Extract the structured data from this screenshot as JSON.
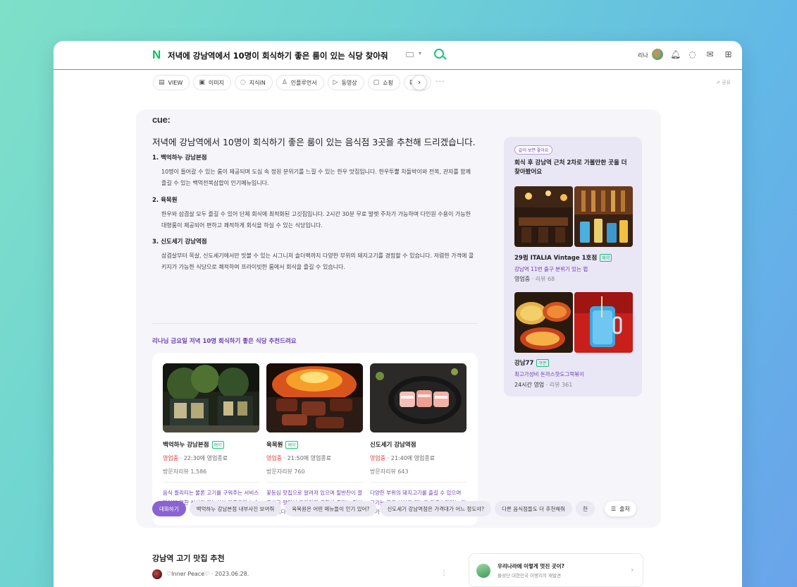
{
  "header": {
    "logo": "N",
    "query": "저녁에 강남역에서 10명이 회식하기 좋은 룸이 있는 식당 찾아줘",
    "user_name": "리나",
    "accent": "#19c37d"
  },
  "tabs": [
    {
      "icon": "▤",
      "label": "VIEW"
    },
    {
      "icon": "▣",
      "label": "이미지"
    },
    {
      "icon": "◌",
      "label": "지식iN"
    },
    {
      "icon": "♙",
      "label": "인플루언서"
    },
    {
      "icon": "▷",
      "label": "동영상"
    },
    {
      "icon": "▢",
      "label": "쇼핑"
    },
    {
      "icon": "▤",
      "label": "뉴"
    }
  ],
  "toolbar": {
    "more": "···",
    "share": "⇗ 공유",
    "next": "›"
  },
  "cue": {
    "logo": "cue:",
    "answer_title": "저녁에 강남역에서 10명이 회식하기 좋은 룸이 있는 음식점 3곳을 추천해 드리겠습니다.",
    "items": [
      {
        "title": "1.  백억하누 강남본점",
        "desc": "10명이 들어갈 수 있는 룸이 제공되며 도심 속 정원 분위기를 느낄 수 있는 한우 맛집입니다. 한우투뿔 차돌박이와 전복, 관자를 함께 즐길 수 있는 백억전복삼합이 인기메뉴입니다."
      },
      {
        "title": "2.  육목원",
        "desc": "한우와 삼겹살 모두 즐길 수 있어 단체 회식에 최적화된 고깃집입니다. 2시간 30분 무료 발렛 주차가 가능하며 다인원 수용이 가능한 대형룸이 제공되어 편하고 쾌적하게 회식을 하실 수 있는 식당입니다."
      },
      {
        "title": "3.  신도세기 강남역점",
        "desc": "삼겹살부터 목살, 신도세기에서만 맛볼 수 있는 시그니처 솔더랙까지 다양한 부위의 돼지고기를 경험할 수 있습니다. 저렴한 가격에 콜키지가 가능한 식당으로 쾌적하며 프라이빗한 룸에서 회식을 즐길 수 있습니다."
      }
    ],
    "reco_title": "리나님 금요일 저녁 10명 회식하기 좋은 식당 추천드려요",
    "cards": [
      {
        "name": "백억하누 강남본점",
        "badge": "예약",
        "status": "영업중",
        "close": " · 22:30에 영업종료",
        "review": "방문자리뷰 1,586",
        "desc": "음식 퀄리티는 물론 고기를 구워주는 서비스 덕분에 편한 식사가 가능하여 만족도가 높습니다."
      },
      {
        "name": "육목원",
        "badge": "예약",
        "status": "영업중",
        "close": " · 21:50에 영업종료",
        "review": "방문자리뷰 760",
        "desc": "꽃등심 맛집으로 알려져 있으며 밑반찬이 깔끔하고 맛있어 고기와의 궁합이 좋다는 평이 많습니다."
      },
      {
        "name": "신도세기 강남역점",
        "badge": "",
        "status": "영업중",
        "close": " · 21:40에 영업종료",
        "review": "방문자리뷰 643",
        "desc": "다양한 부위의 돼지고기를 즐길 수 있으며 고기는 물론 사이드 메뉴도 만족스럽다는 리뷰가 많습니다."
      }
    ],
    "side": {
      "tag": "같이 보면 좋아요",
      "title": "회식 후 강남역 근처 2차로 가볼만한 곳을 더 찾아봤어요",
      "places": [
        {
          "name": "29펍 ITALIA Vintage 1호점",
          "badge": "예약",
          "desc": "강남역 11번 출구 분위기 있는 펍",
          "status": "영업중",
          "review": " · 리뷰 68"
        },
        {
          "name": "강남77",
          "badge": "쿠폰",
          "desc": "최고가성비 돈까스핫도그떡볶이",
          "status": "24시간 영업",
          "review": " · 리뷰 361"
        }
      ]
    },
    "chips": [
      "대화하기",
      "백억하누 강남본점 내부사진 보여줘",
      "육목원은 어떤 메뉴들이 인기 있어?",
      "신도세기 강남역점은 가격대가 어느 정도야?",
      "다른 음식점들도 더 추천해줘",
      "한"
    ],
    "list_label": "출처"
  },
  "blog": {
    "title": "강남역 고기 맛집 추천",
    "author": "♡Inner Peace♡ · 2023.06.28.",
    "more": "⋮"
  },
  "related": {
    "title": "우리나라에 이렇게 멋진 곳이?",
    "sub": "불성단 대한민국 이맹지의 재발견",
    "arrow": "›"
  }
}
